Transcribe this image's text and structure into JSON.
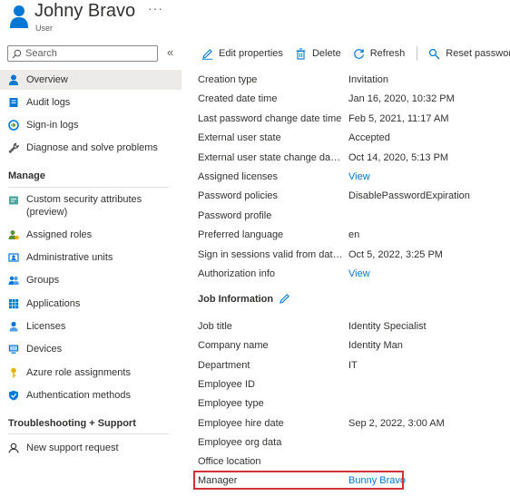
{
  "header": {
    "title": "Johny Bravo",
    "subtitle": "User",
    "more": "···"
  },
  "search": {
    "placeholder": "Search"
  },
  "sidebar": {
    "collapse": "«",
    "items": [
      {
        "label": "Overview",
        "icon": "user-icon",
        "color": "#0078d4"
      },
      {
        "label": "Audit logs",
        "icon": "audit-logs-icon",
        "color": "#0078d4"
      },
      {
        "label": "Sign-in logs",
        "icon": "sign-in-logs-icon",
        "color": "#0078d4"
      },
      {
        "label": "Diagnose and solve problems",
        "icon": "wrench-icon",
        "color": "#323130"
      }
    ],
    "manage_header": "Manage",
    "manage_items": [
      {
        "label": "Custom security attributes (preview)",
        "icon": "custom-attributes-icon",
        "color": "#4ea6a0"
      },
      {
        "label": "Assigned roles",
        "icon": "assigned-roles-icon",
        "color": "#5c8f3e"
      },
      {
        "label": "Administrative units",
        "icon": "admin-units-icon",
        "color": "#0078d4"
      },
      {
        "label": "Groups",
        "icon": "groups-icon",
        "color": "#0078d4"
      },
      {
        "label": "Applications",
        "icon": "applications-icon",
        "color": "#0078d4"
      },
      {
        "label": "Licenses",
        "icon": "licenses-icon",
        "color": "#0078d4"
      },
      {
        "label": "Devices",
        "icon": "devices-icon",
        "color": "#0078d4"
      },
      {
        "label": "Azure role assignments",
        "icon": "key-icon",
        "color": "#e8b400"
      },
      {
        "label": "Authentication methods",
        "icon": "shield-icon",
        "color": "#0078d4"
      }
    ],
    "support_header": "Troubleshooting + Support",
    "support_items": [
      {
        "label": "New support request",
        "icon": "support-icon",
        "color": "#323130"
      }
    ]
  },
  "toolbar": {
    "edit": "Edit properties",
    "delete": "Delete",
    "refresh": "Refresh",
    "reset": "Reset password"
  },
  "properties": [
    {
      "key": "Creation type",
      "value": "Invitation"
    },
    {
      "key": "Created date time",
      "value": "Jan 16, 2020, 10:32 PM"
    },
    {
      "key": "Last password change date time",
      "value": "Feb 5, 2021, 11:17 AM"
    },
    {
      "key": "External user state",
      "value": "Accepted"
    },
    {
      "key": "External user state change date time",
      "value": "Oct 14, 2020, 5:13 PM"
    },
    {
      "key": "Assigned licenses",
      "value": "View",
      "link": true
    },
    {
      "key": "Password policies",
      "value": "DisablePasswordExpiration"
    },
    {
      "key": "Password profile",
      "value": ""
    },
    {
      "key": "Preferred language",
      "value": "en"
    },
    {
      "key": "Sign in sessions valid from date time",
      "value": "Oct 5, 2022, 3:25 PM"
    },
    {
      "key": "Authorization info",
      "value": "View",
      "link": true
    }
  ],
  "job_header": "Job Information",
  "job": [
    {
      "key": "Job title",
      "value": "Identity Specialist"
    },
    {
      "key": "Company name",
      "value": "Identity Man"
    },
    {
      "key": "Department",
      "value": "IT"
    },
    {
      "key": "Employee ID",
      "value": ""
    },
    {
      "key": "Employee type",
      "value": ""
    },
    {
      "key": "Employee hire date",
      "value": "Sep 2, 2022, 3:00 AM"
    },
    {
      "key": "Employee org data",
      "value": ""
    },
    {
      "key": "Office location",
      "value": ""
    },
    {
      "key": "Manager",
      "value": "Bunny Bravo",
      "link": true
    }
  ]
}
